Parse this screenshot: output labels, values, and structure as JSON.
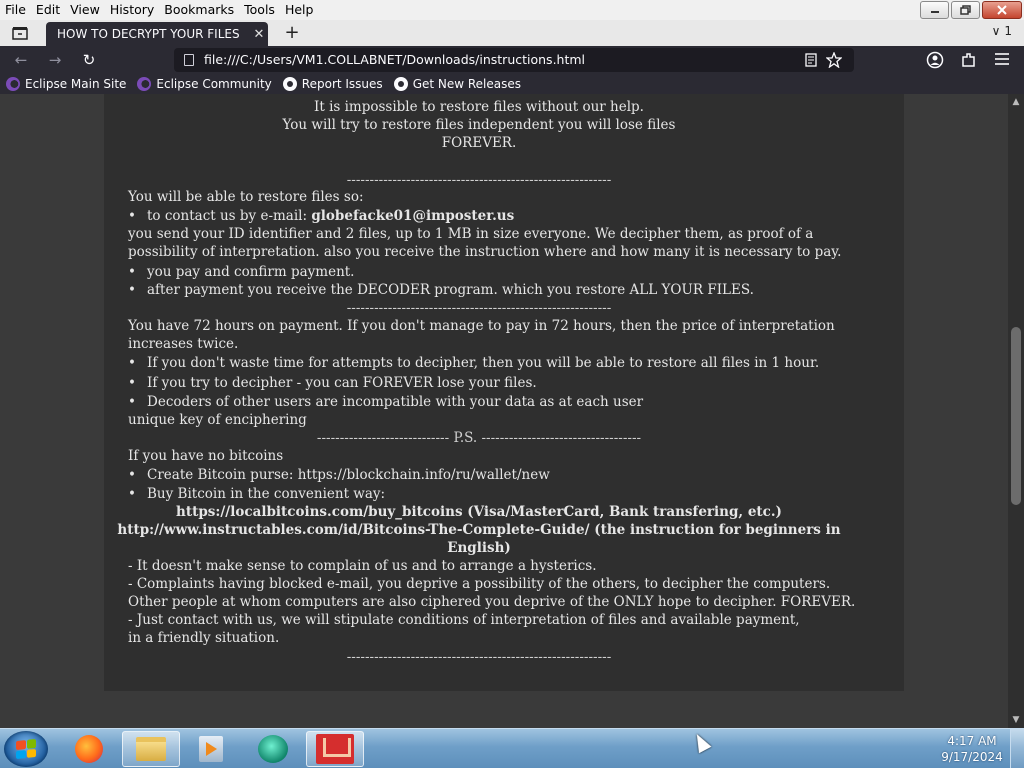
{
  "menubar": {
    "items": [
      "File",
      "Edit",
      "View",
      "History",
      "Bookmarks",
      "Tools",
      "Help"
    ]
  },
  "window_controls": {
    "minimize_icon": "minimize-icon",
    "restore_icon": "restore-icon",
    "close_icon": "close-icon"
  },
  "tabs": {
    "active_title": "HOW TO DECRYPT YOUR FILES",
    "close_glyph": "✕",
    "new_tab_glyph": "+",
    "list_all_glyph": "∨",
    "count": "1"
  },
  "navbar": {
    "url": "file:///C:/Users/VM1.COLLABNET/Downloads/instructions.html",
    "back_glyph": "←",
    "forward_glyph": "→",
    "reload_glyph": "↻"
  },
  "bookmarks": [
    {
      "label": "Eclipse Main Site",
      "icon": "eclipse-icon"
    },
    {
      "label": "Eclipse Community",
      "icon": "eclipse-icon"
    },
    {
      "label": "Report Issues",
      "icon": "github-icon"
    },
    {
      "label": "Get New Releases",
      "icon": "github-icon"
    }
  ],
  "note": {
    "top1": "It is impossible to restore files without our help.",
    "top2": "You will try to restore files independent you will lose files",
    "top3": "FOREVER.",
    "sep1": "----------------------------------------------------------",
    "restore_intro": "You will be able to restore files so:",
    "contact_prefix": "to contact us by e-mail:",
    "email": "globefacke01@imposter.us",
    "send_line1": "you send your ID identifier and 2 files, up to 1 MB in size everyone. We decipher them, as proof of a",
    "send_line2": "possibility of interpretation. also you receive the instruction where and how many it is necessary to pay.",
    "bullet_pay": "you pay and confirm payment.",
    "bullet_decoder": "after payment you receive the DECODER program. which you restore ALL YOUR FILES.",
    "sep2": "----------------------------------------------------------",
    "hours_line1": "You have 72 hours on payment. If you don't manage to pay in 72 hours, then the price of interpretation",
    "hours_line2": "increases twice.",
    "bullet_waste": "If you don't waste time for attempts to decipher, then you will be able to restore all files in 1 hour.",
    "bullet_try": "If you try to decipher - you can FOREVER lose your files.",
    "bullet_decoders": "Decoders of other users are incompatible with your data as at each user",
    "unique_key": "unique key of enciphering",
    "ps_line": "----------------------------- P.S. -----------------------------------",
    "no_bitcoins": "If you have no bitcoins",
    "bullet_purse": "Create Bitcoin purse: https://blockchain.info/ru/wallet/new",
    "bullet_buy": "Buy Bitcoin in the convenient way:",
    "link_localbitcoins": "https://localbitcoins.com/buy_bitcoins (Visa/MasterCard, Bank transfering, etc.)",
    "link_instructables1": "http://www.instructables.com/id/Bitcoins-The-Complete-Guide/ (the instruction for beginners in",
    "link_instructables2": "English)",
    "complain1": "- It doesn't make sense to complain of us and to arrange a hysterics.",
    "complain2": "- Complaints having blocked e-mail, you deprive a possibility of the others, to decipher the computers.",
    "complain3": "Other people at whom computers are also ciphered you deprive of the ONLY hope to decipher. FOREVER.",
    "complain4": "- Just contact with us, we will stipulate conditions of interpretation of files and available payment,",
    "complain5": "in a friendly situation.",
    "sep3": "----------------------------------------------------------"
  },
  "taskbar": {
    "time": "4:17 AM",
    "date": "9/17/2024",
    "apps": [
      "start-button",
      "firefox-icon",
      "file-explorer-icon",
      "media-player-icon",
      "chat-app-icon",
      "mail-app-icon"
    ]
  },
  "colors": {
    "browser_chrome": "#2b2a33",
    "page_background": "#3a3a3a",
    "note_background": "#2f2f2f",
    "note_text": "#e6e6e6"
  }
}
